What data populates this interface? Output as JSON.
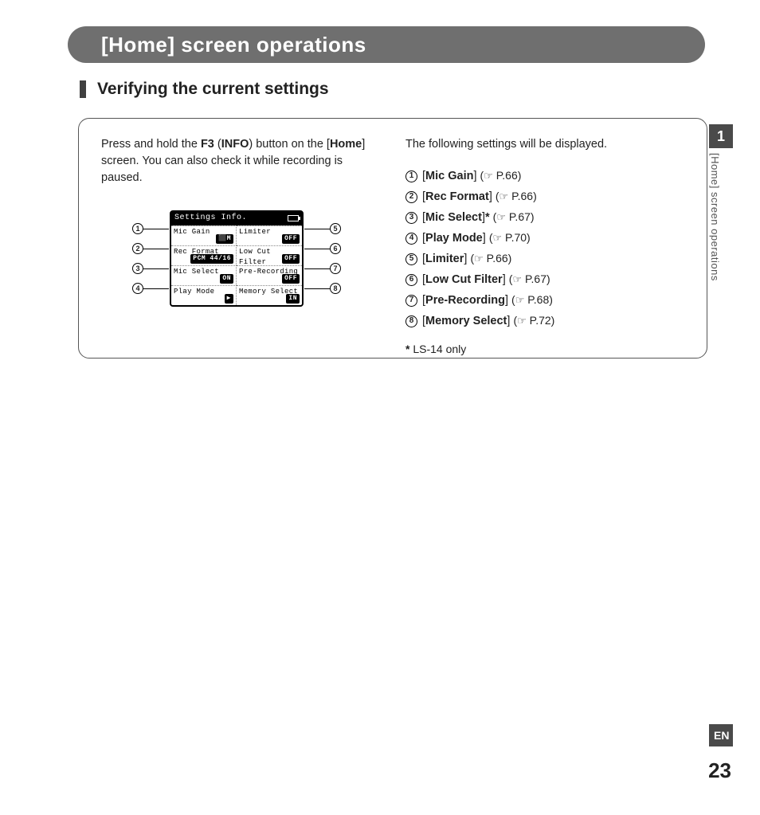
{
  "header": {
    "title": "[Home] screen operations"
  },
  "subheading": "Verifying the current settings",
  "left_column": {
    "intro_prefix": "Press and hold the ",
    "intro_button": "F3",
    "intro_paren_open": " (",
    "intro_info": "INFO",
    "intro_paren_close": ") button on the [",
    "intro_home": "Home",
    "intro_suffix": "] screen. You can also check it while recording is paused."
  },
  "lcd": {
    "title": "Settings Info.",
    "cells": [
      {
        "label": "Mic Gain",
        "value": "⬛M"
      },
      {
        "label": "Limiter",
        "value": "OFF"
      },
      {
        "label": "Rec Format",
        "value": "PCM 44/16"
      },
      {
        "label": "Low Cut Filter",
        "value": "OFF"
      },
      {
        "label": "Mic Select",
        "value": "ON"
      },
      {
        "label": "Pre-Recording",
        "value": "OFF"
      },
      {
        "label": "Play Mode",
        "value": "▶"
      },
      {
        "label": "Memory Select",
        "value": "IN"
      }
    ],
    "callouts_left": [
      "1",
      "2",
      "3",
      "4"
    ],
    "callouts_right": [
      "5",
      "6",
      "7",
      "8"
    ]
  },
  "right_column": {
    "intro": "The following settings will be displayed.",
    "items": [
      {
        "num": "1",
        "name": "Mic Gain",
        "suffix": "",
        "page": "P.66"
      },
      {
        "num": "2",
        "name": "Rec Format",
        "suffix": "",
        "page": "P.66"
      },
      {
        "num": "3",
        "name": "Mic Select",
        "suffix": "*",
        "page": "P.67"
      },
      {
        "num": "4",
        "name": "Play Mode",
        "suffix": "",
        "page": "P.70"
      },
      {
        "num": "5",
        "name": "Limiter",
        "suffix": "",
        "page": "P.66"
      },
      {
        "num": "6",
        "name": "Low Cut Filter",
        "suffix": "",
        "page": "P.67"
      },
      {
        "num": "7",
        "name": "Pre-Recording",
        "suffix": "",
        "page": "P.68"
      },
      {
        "num": "8",
        "name": "Memory Select",
        "suffix": "",
        "page": "P.72"
      }
    ],
    "footnote_marker": "*",
    "footnote_text": " LS-14 only"
  },
  "side": {
    "chapter_num": "1",
    "running_head": "[Home] screen operations"
  },
  "footer": {
    "lang": "EN",
    "page": "23"
  }
}
